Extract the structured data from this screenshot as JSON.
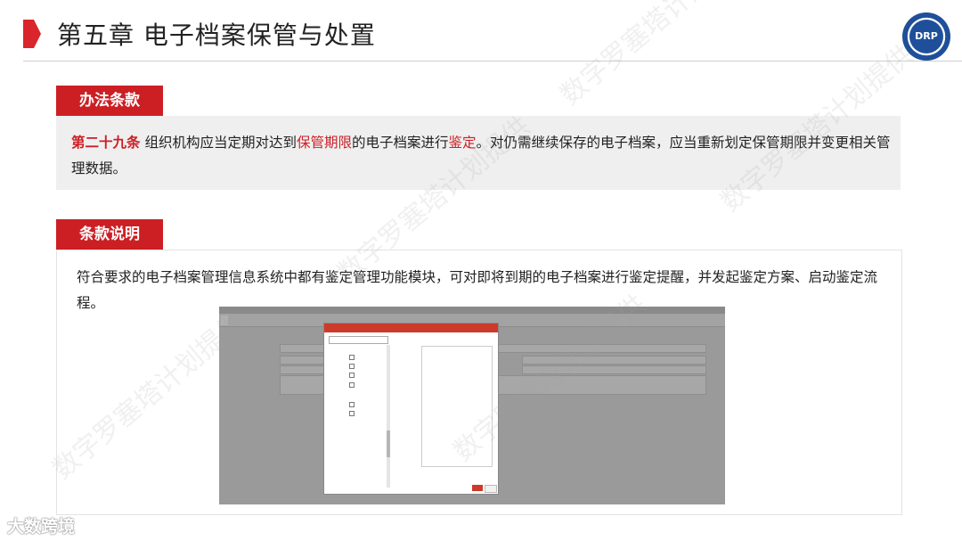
{
  "header": {
    "title": "第五章 电子档案保管与处置",
    "logo_text": "DRP"
  },
  "section1": {
    "tab_label": "办法条款",
    "article_no": "第二十九条",
    "text_a": " 组织机构应当定期对达到",
    "hl1": "保管期限",
    "text_b": "的电子档案进行",
    "hl2": "鉴定",
    "text_c": "。对仍需继续保存的电子档案，应当重新划定保管期限并变更相关管理数据。"
  },
  "section2": {
    "tab_label": "条款说明",
    "text": "符合要求的电子档案管理信息系统中都有鉴定管理功能模块，可对即将到期的电子档案进行鉴定提醒，并发起鉴定方案、启动鉴定流程。"
  },
  "watermark": {
    "text": "数字罗塞塔计划提供"
  },
  "footer": {
    "brand": "大数跨境"
  },
  "colors": {
    "accent": "#cc1f24",
    "box_bg": "#efefef"
  }
}
